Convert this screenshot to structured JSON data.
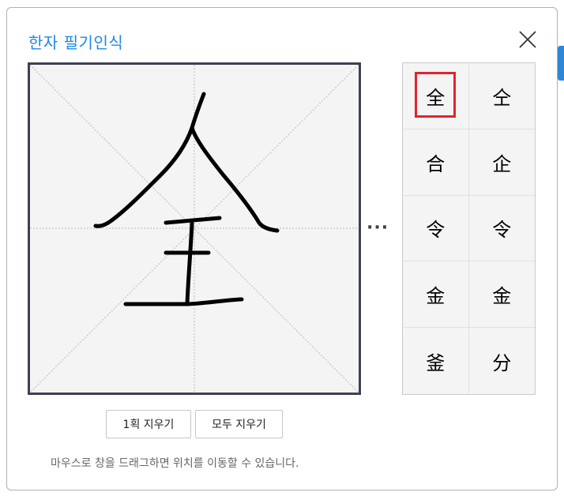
{
  "dialog": {
    "title": "한자 필기인식",
    "close_icon": "close-icon"
  },
  "canvas": {
    "guide_lines": "dotted-crosshair-and-diagonals",
    "ink_color": "#000000"
  },
  "more_label": "···",
  "candidates": [
    {
      "char": "全",
      "selected": true
    },
    {
      "char": "仝"
    },
    {
      "char": "合"
    },
    {
      "char": "企"
    },
    {
      "char": "令"
    },
    {
      "char": "令"
    },
    {
      "char": "金"
    },
    {
      "char": "金"
    },
    {
      "char": "釜"
    },
    {
      "char": "分"
    }
  ],
  "buttons": {
    "undo_stroke": "1획 지우기",
    "clear_all": "모두 지우기"
  },
  "hint": "마우스로 창을 드래그하면 위치를 이동할 수 있습니다.",
  "colors": {
    "accent": "#1e88e5",
    "selection": "#e0242c",
    "frame": "#3c4152"
  }
}
